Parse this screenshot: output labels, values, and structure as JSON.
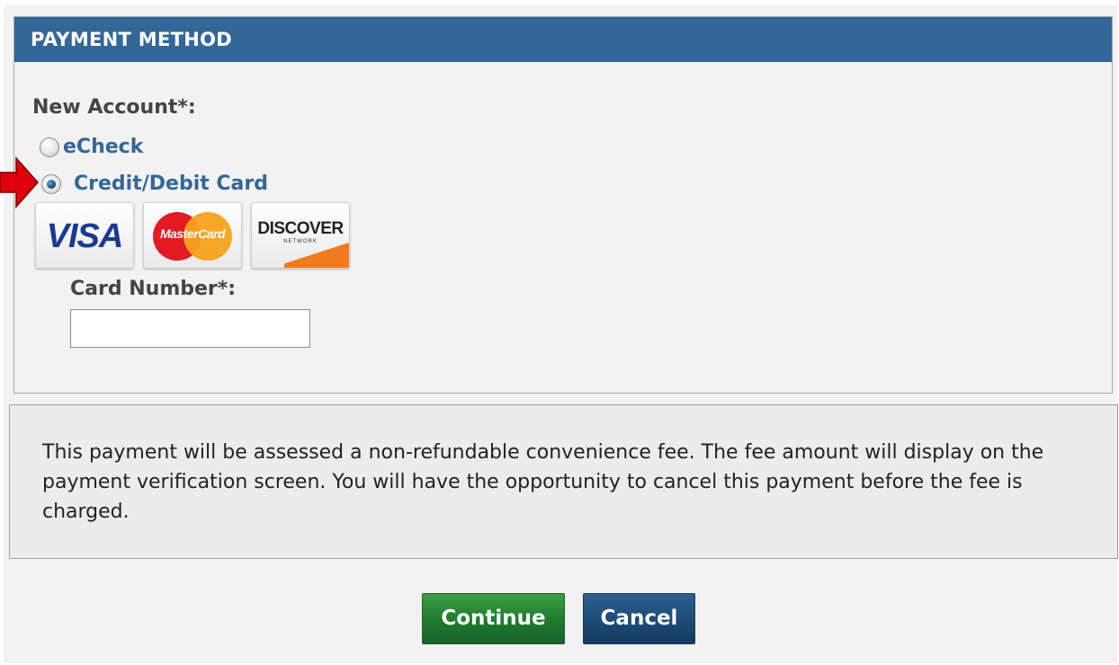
{
  "panel": {
    "title": "PAYMENT METHOD",
    "new_account_label": "New Account*:",
    "options": [
      {
        "label": "eCheck",
        "checked": false
      },
      {
        "label": "Credit/Debit Card",
        "checked": true
      }
    ],
    "card_logos": [
      {
        "name": "visa",
        "text": "VISA"
      },
      {
        "name": "mastercard",
        "text": "MasterCard"
      },
      {
        "name": "discover",
        "text": "DISCOVER",
        "subtext": "NETWORK"
      }
    ],
    "card_number_label": "Card Number*:",
    "card_number_value": ""
  },
  "notice": {
    "text": "This payment will be assessed a non-refundable convenience fee. The fee amount will display on the payment verification screen. You will have the opportunity to cancel this payment before the fee is charged."
  },
  "buttons": {
    "continue_label": "Continue",
    "cancel_label": "Cancel"
  },
  "colors": {
    "header": "#336699",
    "link": "#336699",
    "continue": "#1f7a2c",
    "cancel": "#1d4b76",
    "arrow": "#e0000b"
  }
}
